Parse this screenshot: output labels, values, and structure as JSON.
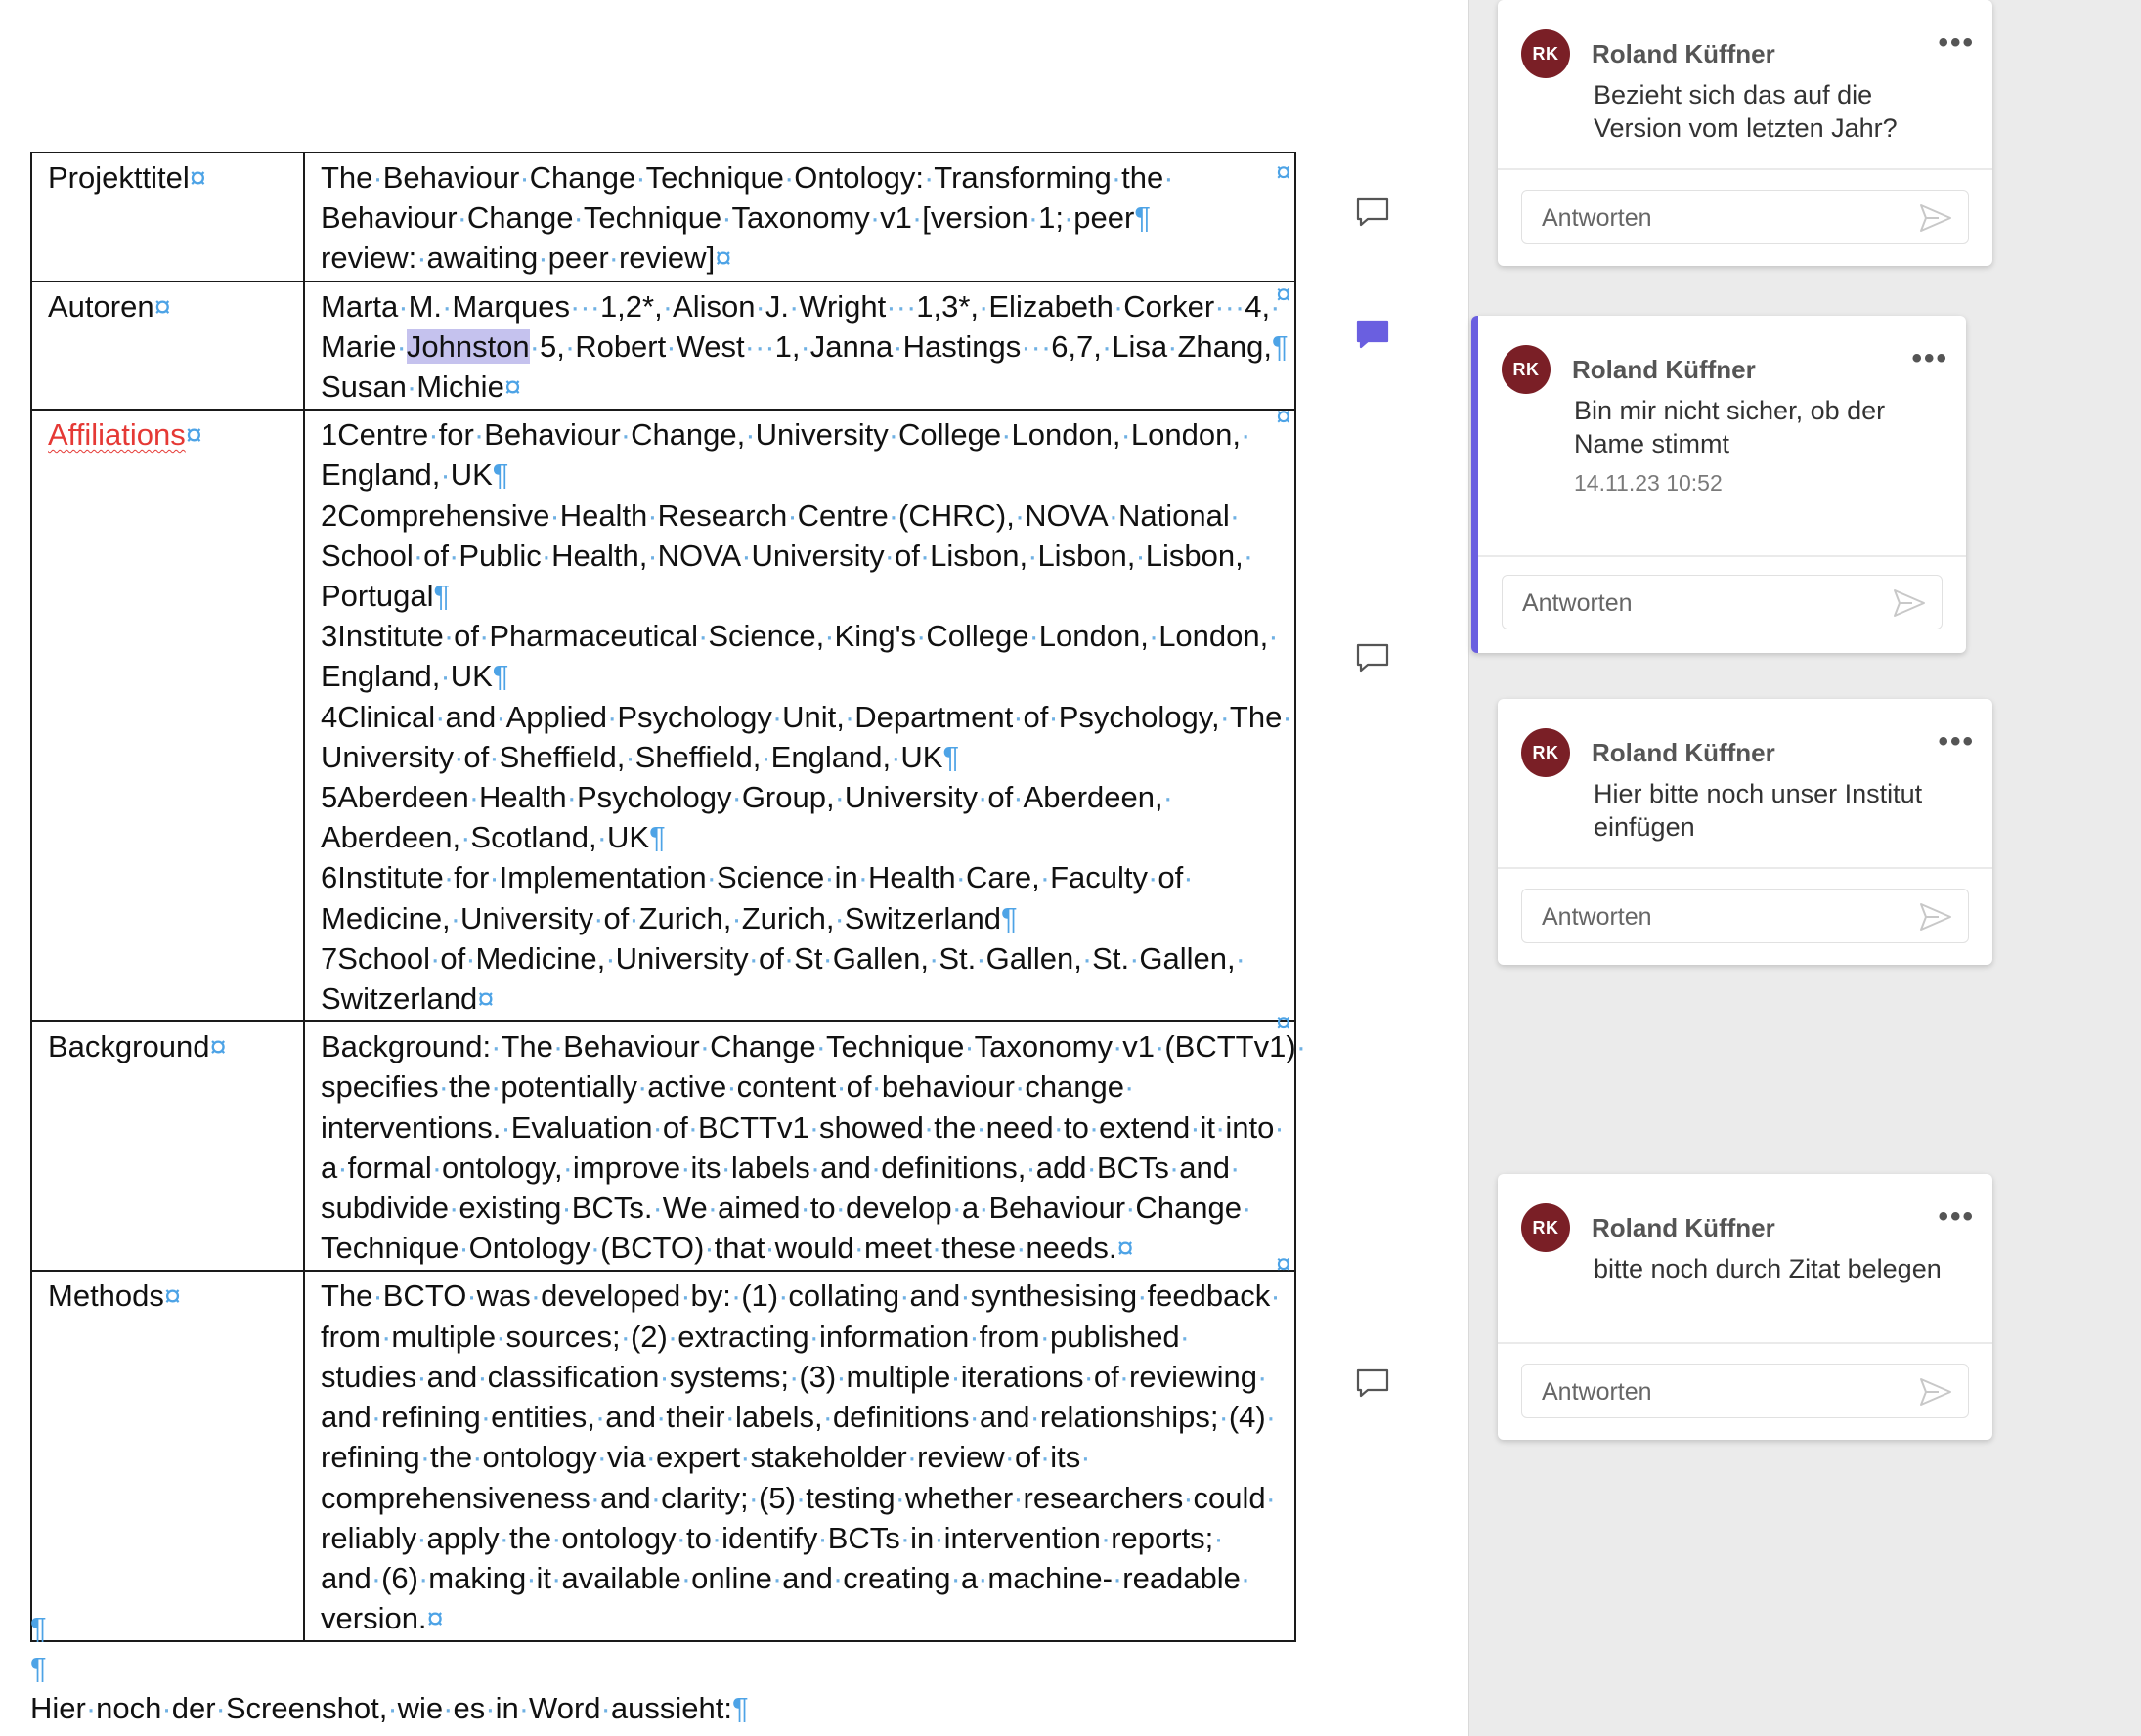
{
  "document": {
    "rows": [
      {
        "label": "Projekttitel",
        "lines": [
          "The·Behaviour·Change·Technique·Ontology:·Transforming·the·",
          "Behaviour·Change·Technique·Taxonomy·v1·[version·1;·peer",
          "review:·awaiting·peer·review]"
        ]
      },
      {
        "label": "Autoren",
        "lines": [
          "Marta·M.·Marques···1,2*,·Alison·J.·Wright···1,3*,·Elizabeth·Corker···4,·",
          "Marie·Johnston·5,·Robert·West···1,·Janna·Hastings···6,7,·Lisa·Zhang,",
          "Susan·Michie"
        ]
      },
      {
        "label": "Affiliations",
        "lines": [
          "1Centre·for·Behaviour·Change,·University·College·London,·London,·",
          "England,·UK",
          "2Comprehensive·Health·Research·Centre·(CHRC),·NOVA·National·",
          "School·of·Public·Health,·NOVA·University·of·Lisbon,·Lisbon,·Lisbon,·",
          "Portugal",
          "3Institute·of·Pharmaceutical·Science,·King's·College·London,·London,·",
          "England,·UK",
          "4Clinical·and·Applied·Psychology·Unit,·Department·of·Psychology,·The·",
          "University·of·Sheffield,·Sheffield,·England,·UK",
          "5Aberdeen·Health·Psychology·Group,·University·of·Aberdeen,·",
          "Aberdeen,·Scotland,·UK",
          "6Institute·for·Implementation·Science·in·Health·Care,·Faculty·of·",
          "Medicine,·University·of·Zurich,·Zurich,·Switzerland",
          "7School·of·Medicine,·University·of·St·Gallen,·St.·Gallen,·St.·Gallen,·",
          "Switzerland"
        ]
      },
      {
        "label": "Background",
        "lines": [
          "Background:·The·Behaviour·Change·Technique·Taxonomy·v1·(BCTTv1)·",
          "specifies·the·potentially·active·content·of·behaviour·change·",
          "interventions.·Evaluation·of·BCTTv1·showed·the·need·to·extend·it·into·",
          "a·formal·ontology,·improve·its·labels·and·definitions,·add·BCTs·and·",
          "subdivide·existing·BCTs.·We·aimed·to·develop·a·Behaviour·Change·",
          "Technique·Ontology·(BCTO)·that·would·meet·these·needs."
        ]
      },
      {
        "label": "Methods",
        "lines": [
          "The·BCTO·was·developed·by:·(1)·collating·and·synthesising·feedback·",
          "from·multiple·sources;·(2)·extracting·information·from·published·",
          "studies·and·classification·systems;·(3)·multiple·iterations·of·reviewing·",
          "and·refining·entities,·and·their·labels,·definitions·and·relationships;·(4)·",
          "refining·the·ontology·via·expert·stakeholder·review·of·its·",
          "comprehensiveness·and·clarity;·(5)·testing·whether·researchers·could·",
          "reliably·apply·the·ontology·to·identify·BCTs·in·intervention·reports;·",
          "and·(6)·making·it·available·online·and·creating·a·machine-·readable·",
          "version."
        ]
      }
    ],
    "after_paragraph": "Hier·noch·der·Screenshot,·wie·es·in·Word·aussieht:",
    "pilcrow": "¶",
    "cell_mark": "¤"
  },
  "comments": [
    {
      "initials": "RK",
      "author": "Roland Küffner",
      "text": "Bezieht sich das auf die Version vom letzten Jahr?",
      "timestamp": "",
      "reply_placeholder": "Antworten",
      "active": false
    },
    {
      "initials": "RK",
      "author": "Roland Küffner",
      "text": "Bin mir nicht sicher, ob der Name stimmt",
      "timestamp": "14.11.23 10:52",
      "reply_placeholder": "Antworten",
      "active": true
    },
    {
      "initials": "RK",
      "author": "Roland Küffner",
      "text": "Hier bitte noch unser Institut einfügen",
      "timestamp": "",
      "reply_placeholder": "Antworten",
      "active": false
    },
    {
      "initials": "RK",
      "author": "Roland Küffner",
      "text": "bitte noch durch Zitat belegen",
      "timestamp": "",
      "reply_placeholder": "Antworten",
      "active": false
    }
  ],
  "colors": {
    "accent": "#6a5fe0",
    "avatar": "#7a1f26",
    "formatting_marks": "#4da3e6",
    "spelling": "#e53935"
  },
  "icons": {
    "comment": "comment-icon",
    "comment_active": "comment-filled-icon",
    "send": "send-icon",
    "more": "more-icon"
  }
}
